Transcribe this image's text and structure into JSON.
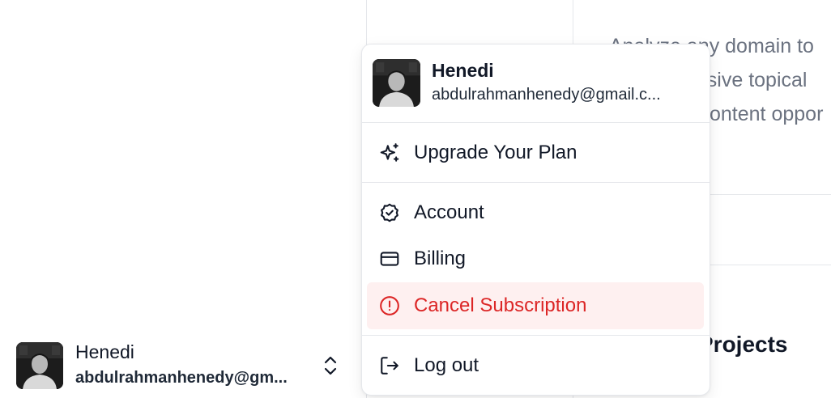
{
  "background": {
    "description_lines": [
      "Analyze any domain to",
      "ensive topical",
      "ontent oppor"
    ],
    "section_title": "Projects"
  },
  "user_footer": {
    "name": "Henedi",
    "email": "abdulrahmanhenedy@gm...",
    "toggle_icon": "chevrons-up-down-icon"
  },
  "menu": {
    "name": "Henedi",
    "email": "abdulrahmanhenedy@gmail.c...",
    "items": [
      {
        "label": "Upgrade Your Plan",
        "icon": "sparkles-icon"
      },
      {
        "label": "Account",
        "icon": "badge-check-icon"
      },
      {
        "label": "Billing",
        "icon": "credit-card-icon"
      },
      {
        "label": "Cancel Subscription",
        "icon": "alert-circle-icon"
      },
      {
        "label": "Log out",
        "icon": "log-out-icon"
      }
    ]
  },
  "colors": {
    "danger": "#dc2626",
    "danger_bg": "#fef0f0",
    "border": "#e5e7eb",
    "muted_text": "#6b7280"
  }
}
